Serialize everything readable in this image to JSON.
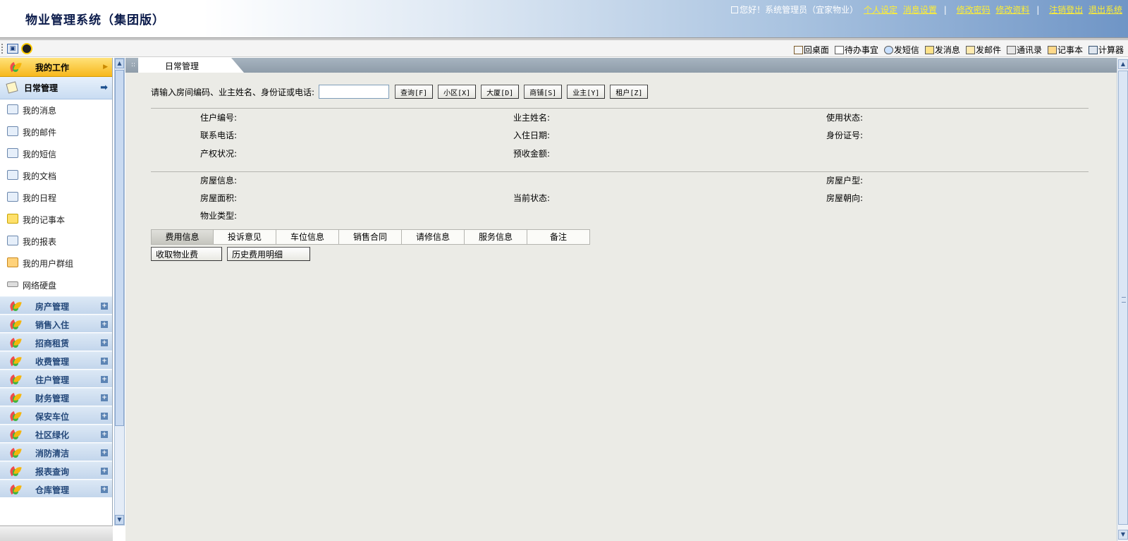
{
  "header": {
    "title": "物业管理系统（集团版）",
    "greeting": "您好！系统管理员（宜家物业）",
    "links": [
      "个人设定",
      "消息设置",
      "修改密码",
      "修改资料",
      "注销登出",
      "退出系统"
    ]
  },
  "toolbar": {
    "items": [
      "回桌面",
      "待办事宜",
      "发短信",
      "发消息",
      "发邮件",
      "通讯录",
      "记事本",
      "计算器"
    ]
  },
  "sidebar": {
    "mywork": "我的工作",
    "daily": "日常管理",
    "items": [
      "我的消息",
      "我的邮件",
      "我的短信",
      "我的文档",
      "我的日程",
      "我的记事本",
      "我的报表",
      "我的用户群组",
      "网络硬盘"
    ],
    "sections": [
      "房产管理",
      "销售入住",
      "招商租赁",
      "收费管理",
      "住户管理",
      "财务管理",
      "保安车位",
      "社区绿化",
      "消防清洁",
      "报表查询",
      "仓库管理"
    ]
  },
  "main": {
    "tab_title": "日常管理",
    "search": {
      "prompt": "请输入房间编码、业主姓名、身份证或电话:",
      "value": "",
      "buttons": [
        "查询[F]",
        "小区[X]",
        "大厦[D]",
        "商铺[S]",
        "业主[Y]",
        "租户[Z]"
      ]
    },
    "info1": {
      "resident_no": "住户编号:",
      "owner_name": "业主姓名:",
      "use_status": "使用状态:",
      "phone": "联系电话:",
      "checkin_date": "入住日期:",
      "id_no": "身份证号:",
      "property_status": "产权状况:",
      "prepaid": "预收金额:"
    },
    "info2": {
      "house_info": "房屋信息:",
      "house_type": "房屋户型:",
      "house_area": "房屋面积:",
      "current_status": "当前状态:",
      "orientation": "房屋朝向:",
      "property_type": "物业类型:"
    },
    "subtabs": [
      "费用信息",
      "投诉意见",
      "车位信息",
      "销售合同",
      "请修信息",
      "服务信息",
      "备注"
    ],
    "actions": [
      "收取物业费",
      "历史费用明细"
    ]
  },
  "colors": {
    "header_title": "#0a1a4a",
    "header_link": "#ffee33",
    "mywork_bg": "#f7b81c",
    "section_text": "#24487a",
    "main_bg": "#ebebe6"
  }
}
